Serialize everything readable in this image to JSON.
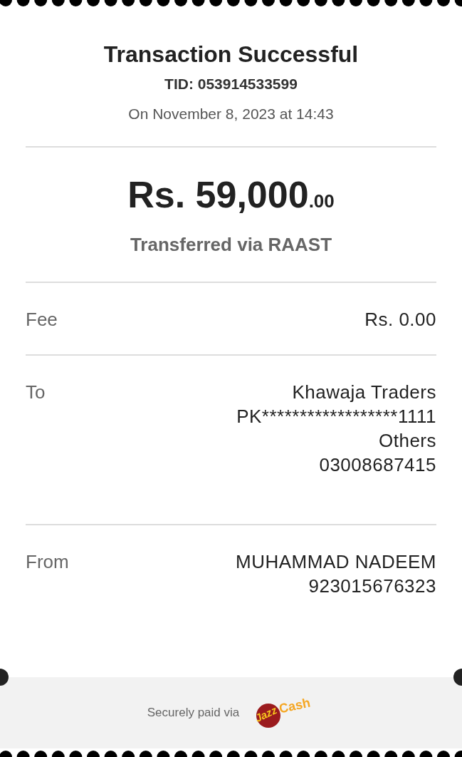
{
  "header": {
    "title": "Transaction Successful",
    "tid": "TID: 053914533599",
    "date": "On November 8, 2023 at 14:43"
  },
  "amount": {
    "main": "Rs. 59,000",
    "decimals": ".00",
    "method": "Transferred via RAAST"
  },
  "rows": [
    {
      "label": "Fee",
      "values": [
        "Rs. 0.00"
      ]
    },
    {
      "label": "To",
      "values": [
        "Khawaja Traders",
        "PK******************1111",
        "Others",
        "03008687415"
      ]
    },
    {
      "label": "From",
      "values": [
        "MUHAMMAD NADEEM",
        "923015676323"
      ]
    }
  ],
  "footer": {
    "text": "Securely paid via",
    "logo": {
      "part_1": "Jazz",
      "part_2": "Cash"
    }
  }
}
